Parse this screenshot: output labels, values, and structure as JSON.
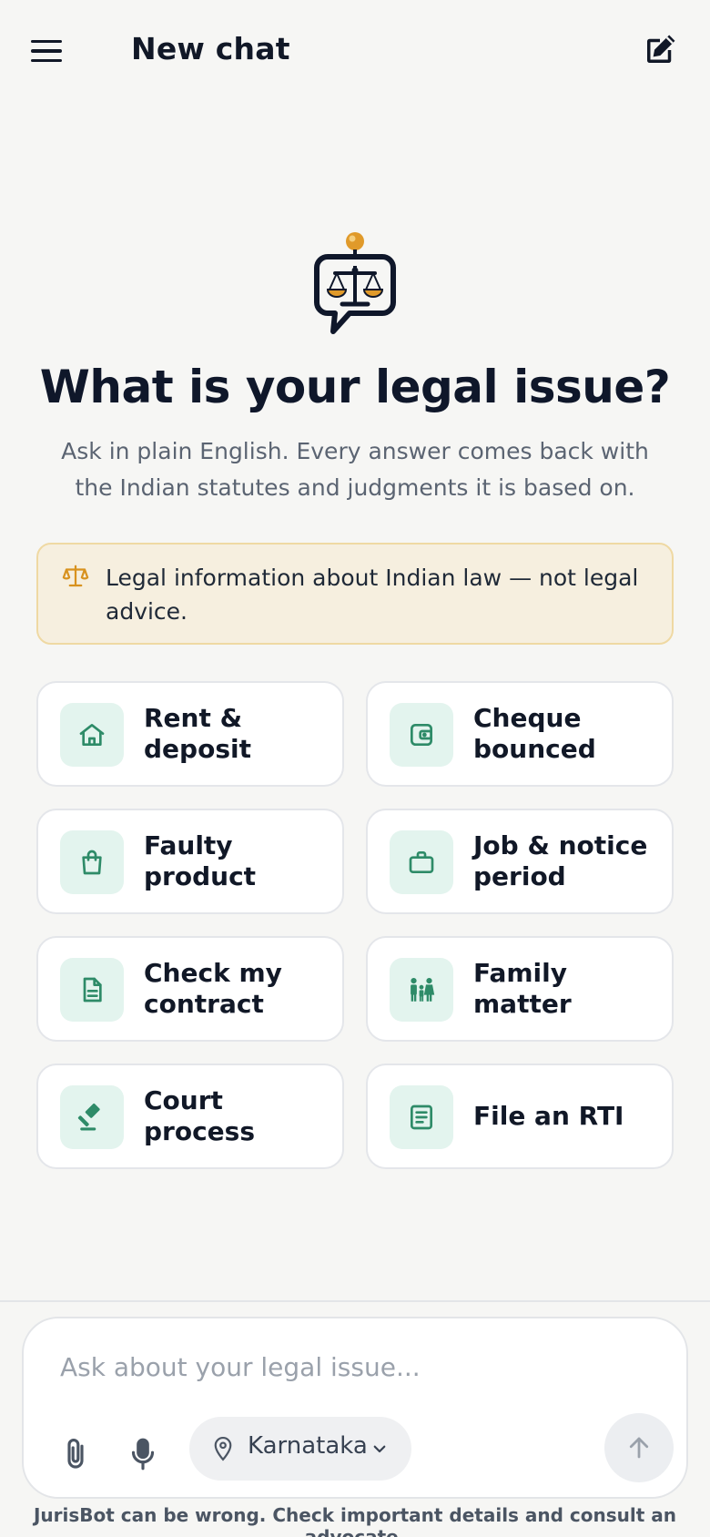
{
  "header": {
    "title": "New chat",
    "menu_icon": "hamburger-menu-icon",
    "compose_icon": "new-chat-compose-icon"
  },
  "hero": {
    "logo_icon": "scales-chat-bubble-logo",
    "title": "What is your legal issue?",
    "subtitle": "Ask in plain English. Every answer comes back with the Indian statutes and judgments it is based on."
  },
  "notice": {
    "icon": "scales-icon",
    "text": "Legal information about Indian law — not legal advice."
  },
  "topics": [
    {
      "label": "Rent & deposit",
      "icon": "home-icon"
    },
    {
      "label": "Cheque bounced",
      "icon": "wallet-icon"
    },
    {
      "label": "Faulty product",
      "icon": "shopping-bag-icon"
    },
    {
      "label": "Job & notice period",
      "icon": "briefcase-icon"
    },
    {
      "label": "Check my contract",
      "icon": "document-icon"
    },
    {
      "label": "Family matter",
      "icon": "family-icon"
    },
    {
      "label": "Court process",
      "icon": "gavel-icon"
    },
    {
      "label": "File an RTI",
      "icon": "form-icon"
    }
  ],
  "composer": {
    "placeholder": "Ask about your legal issue...",
    "state": "Karnataka",
    "attach_icon": "paperclip-icon",
    "mic_icon": "microphone-icon",
    "send_icon": "arrow-up-icon"
  },
  "footer": {
    "disclaimer": "JurisBot can be wrong. Check important details and consult an advocate."
  },
  "colors": {
    "background": "#f6f6f4",
    "accent_green": "#2e8b68",
    "icon_tile": "#e3f4ee",
    "notice_bg": "#f6efdf",
    "notice_border": "#efd9a3",
    "gold": "#d8921f",
    "navy": "#0f172a"
  }
}
